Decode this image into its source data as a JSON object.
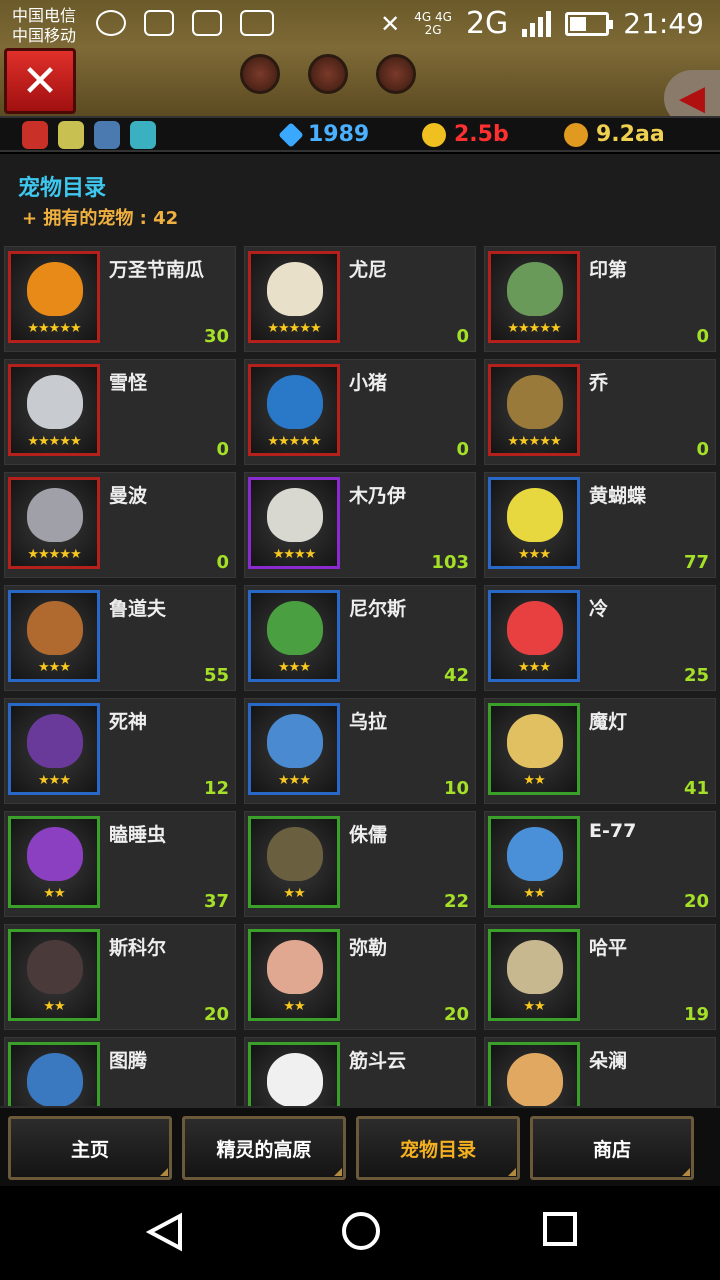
{
  "status_bar": {
    "carrier_1": "中国电信",
    "carrier_2": "中国移动",
    "network_1": "4G 4G",
    "network_2": "2G",
    "network_main": "2G",
    "time": "21:49"
  },
  "resources": {
    "gems": "1989",
    "hero_power": "2.5b",
    "gold": "9.2aa"
  },
  "panel": {
    "title": "宠物目录",
    "owned_label": "+ 拥有的宠物 : 42"
  },
  "pets": [
    {
      "name": "万圣节南瓜",
      "level": "30",
      "stars": "★★★★★",
      "rarity": "red",
      "color": "#e88a18"
    },
    {
      "name": "尤尼",
      "level": "0",
      "stars": "★★★★★",
      "rarity": "red",
      "color": "#e8e0c8"
    },
    {
      "name": "印第",
      "level": "0",
      "stars": "★★★★★",
      "rarity": "red",
      "color": "#6a9a5a"
    },
    {
      "name": "雪怪",
      "level": "0",
      "stars": "★★★★★",
      "rarity": "red",
      "color": "#c8ccd0"
    },
    {
      "name": "小猪",
      "level": "0",
      "stars": "★★★★★",
      "rarity": "red",
      "color": "#2a78c8"
    },
    {
      "name": "乔",
      "level": "0",
      "stars": "★★★★★",
      "rarity": "red",
      "color": "#9a7a3a"
    },
    {
      "name": "曼波",
      "level": "0",
      "stars": "★★★★★",
      "rarity": "red",
      "color": "#a0a0a8"
    },
    {
      "name": "木乃伊",
      "level": "103",
      "stars": "★★★★",
      "rarity": "purple",
      "color": "#d8d8d0"
    },
    {
      "name": "黄蝴蝶",
      "level": "77",
      "stars": "★★★",
      "rarity": "blue",
      "color": "#e8d840"
    },
    {
      "name": "鲁道夫",
      "level": "55",
      "stars": "★★★",
      "rarity": "blue",
      "color": "#b06a30"
    },
    {
      "name": "尼尔斯",
      "level": "42",
      "stars": "★★★",
      "rarity": "blue",
      "color": "#4aa040"
    },
    {
      "name": "冷",
      "level": "25",
      "stars": "★★★",
      "rarity": "blue",
      "color": "#e84040"
    },
    {
      "name": "死神",
      "level": "12",
      "stars": "★★★",
      "rarity": "blue",
      "color": "#6a3a9a"
    },
    {
      "name": "乌拉",
      "level": "10",
      "stars": "★★★",
      "rarity": "blue",
      "color": "#4a8ad0"
    },
    {
      "name": "魔灯",
      "level": "41",
      "stars": "★★",
      "rarity": "green",
      "color": "#e0c060"
    },
    {
      "name": "瞌睡虫",
      "level": "37",
      "stars": "★★",
      "rarity": "green",
      "color": "#8a40c0"
    },
    {
      "name": "侏儒",
      "level": "22",
      "stars": "★★",
      "rarity": "green",
      "color": "#6a6040"
    },
    {
      "name": "E-77",
      "level": "20",
      "stars": "★★",
      "rarity": "green",
      "color": "#4a90d8"
    },
    {
      "name": "斯科尔",
      "level": "20",
      "stars": "★★",
      "rarity": "green",
      "color": "#4a3a3a"
    },
    {
      "name": "弥勒",
      "level": "20",
      "stars": "★★",
      "rarity": "green",
      "color": "#e0a890"
    },
    {
      "name": "哈平",
      "level": "19",
      "stars": "★★",
      "rarity": "green",
      "color": "#c8b890"
    },
    {
      "name": "图腾",
      "level": "",
      "stars": "",
      "rarity": "green",
      "color": "#3a78c0"
    },
    {
      "name": "筋斗云",
      "level": "",
      "stars": "",
      "rarity": "green",
      "color": "#f0f0f0"
    },
    {
      "name": "朵澜",
      "level": "",
      "stars": "",
      "rarity": "green",
      "color": "#e0a860"
    }
  ],
  "tabs": {
    "home": "主页",
    "plateau": "精灵的高原",
    "pets": "宠物目录",
    "shop": "商店"
  },
  "colors": {
    "panel_title": "#3ec8f0",
    "owned": "#f0b040",
    "level": "#a4e028",
    "active_tab": "#f5b020"
  }
}
